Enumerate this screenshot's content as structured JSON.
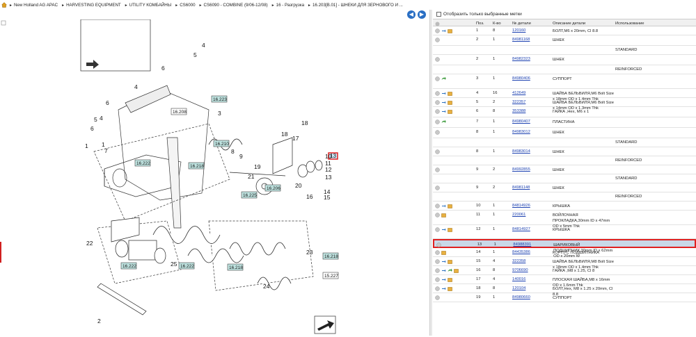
{
  "breadcrumb": [
    "New Holland AG APAC",
    "HARVESTING EQUIPMENT",
    "UTILITY КОМБАЙНЫ",
    "CS6000",
    "CS6090 - COMBINE (9/06-12/08)",
    "16 - Разгрузка",
    "16.203[B.01] - ШНЕКИ ДЛЯ ЗЕРНОВОГО И ..."
  ],
  "filter_label": "Отобразить только выбранные метки",
  "columns": [
    "Поз.",
    "К-во",
    "№ детали",
    "Описание детали",
    "Использование"
  ],
  "rows": [
    {
      "pos": "1",
      "qty": "8",
      "part": "120160",
      "desc": "БОЛТ,M6 x 20mm, Cl 8.8",
      "use": "",
      "icons": [
        "info",
        "swap",
        "box"
      ]
    },
    {
      "pos": "2",
      "qty": "1",
      "part": "84981168",
      "desc": "ШНЕК",
      "use": "",
      "sub": "STANDARD",
      "icons": [
        "info"
      ]
    },
    {
      "pos": "2",
      "qty": "1",
      "part": "84982323",
      "desc": "ШНЕК",
      "use": "",
      "sub": "REINFORCED",
      "icons": [
        "info"
      ]
    },
    {
      "pos": "3",
      "qty": "1",
      "part": "84980406",
      "desc": "СУППОРТ",
      "use": "",
      "icons": [
        "info",
        "arrow"
      ]
    },
    {
      "pos": "4",
      "qty": "16",
      "part": "412649",
      "desc": "ШАЙБА БЕЛЬВИЛЯ,M6 Bolt Size x 18mm OD x 1.4mm Thk",
      "use": "",
      "icons": [
        "info",
        "swap",
        "box"
      ]
    },
    {
      "pos": "5",
      "qty": "2",
      "part": "322357",
      "desc": "ШАЙБА БЕЛЬВИЛЯ,M6 Bolt Size x 14mm OD x 1.3mm Thk",
      "use": "",
      "icons": [
        "info",
        "swap",
        "box"
      ]
    },
    {
      "pos": "6",
      "qty": "8",
      "part": "353388",
      "desc": "ГАЙКА ,Hex, M6 x 1",
      "use": "",
      "icons": [
        "info",
        "swap",
        "box"
      ]
    },
    {
      "pos": "7",
      "qty": "1",
      "part": "84980407",
      "desc": "ПЛАСТИНА",
      "use": "",
      "icons": [
        "info",
        "arrow"
      ]
    },
    {
      "pos": "8",
      "qty": "1",
      "part": "84983012",
      "desc": "ШНЕК",
      "use": "",
      "sub": "STANDARD",
      "icons": [
        "info"
      ]
    },
    {
      "pos": "8",
      "qty": "1",
      "part": "84983014",
      "desc": "ШНЕК",
      "use": "",
      "sub": "REINFORCED",
      "icons": [
        "info"
      ]
    },
    {
      "pos": "9",
      "qty": "2",
      "part": "84992855",
      "desc": "ШНЕК",
      "use": "",
      "sub": "STANDARD",
      "icons": [
        "info"
      ]
    },
    {
      "pos": "9",
      "qty": "2",
      "part": "84981148",
      "desc": "ШНЕК",
      "use": "",
      "sub": "REINFORCED",
      "icons": [
        "info"
      ]
    },
    {
      "pos": "10",
      "qty": "1",
      "part": "84814926",
      "desc": "КРЫШКА",
      "use": "",
      "icons": [
        "info",
        "swap",
        "box"
      ]
    },
    {
      "pos": "11",
      "qty": "1",
      "part": "220061",
      "desc": "ВОЙЛОЧНАЯ ПРОКЛАДКА,30mm ID x 47mm OD x 5mm Thk",
      "use": "",
      "icons": [
        "info",
        "box"
      ]
    },
    {
      "pos": "12",
      "qty": "1",
      "part": "84814927",
      "desc": "КРЫШКА",
      "use": "",
      "icons": [
        "info",
        "swap",
        "box"
      ]
    },
    {
      "pos": "13",
      "qty": "1",
      "part": "84988391",
      "desc": "ШАРИКОВЫЙ ПОДШИПНИК,30mm ID x 62mm OD x 20mm W",
      "use": "",
      "selected": true,
      "icons": [
        "info"
      ]
    },
    {
      "pos": "14",
      "qty": "1",
      "part": "84435386",
      "desc": "КОРПУС ПОДШИПНИКА",
      "use": "",
      "icons": [
        "info",
        "box"
      ]
    },
    {
      "pos": "15",
      "qty": "4",
      "part": "322358",
      "desc": "ШАЙБА БЕЛЬВИЛЯ,M8 Bolt Size x 18mm OD x 1.4mm Thk",
      "use": "",
      "icons": [
        "info",
        "swap",
        "box"
      ]
    },
    {
      "pos": "16",
      "qty": "8",
      "part": "9706690",
      "desc": "ГАЙКА ,M8 x 1.25, Cl 8",
      "use": "",
      "icons": [
        "info",
        "swap",
        "arrow",
        "box"
      ]
    },
    {
      "pos": "17",
      "qty": "4",
      "part": "140016",
      "desc": "ПЛОСКАЯ ШАЙБА,M8 x 16mm OD x 1.6mm Thk",
      "use": "",
      "icons": [
        "info",
        "swap",
        "box"
      ]
    },
    {
      "pos": "18",
      "qty": "8",
      "part": "120104",
      "desc": "БОЛТ,Hex, M8 x 1.25 x 20mm, Cl 8.8",
      "use": "",
      "icons": [
        "info",
        "swap",
        "box"
      ]
    },
    {
      "pos": "19",
      "qty": "1",
      "part": "84980660",
      "desc": "СУППОРТ",
      "use": "",
      "icons": [
        "info"
      ]
    }
  ],
  "callouts": [
    "16.208",
    "16.223",
    "16.210",
    "16.222",
    "16.218",
    "16.206",
    "16.225",
    "16.222",
    "16.222",
    "16.218",
    "16.218",
    "15.227",
    "13"
  ],
  "diagram_numbers": [
    "4",
    "5",
    "6",
    "4",
    "6",
    "5",
    "4",
    "6",
    "1",
    "1",
    "7",
    "3",
    "18",
    "17",
    "18",
    "19",
    "9",
    "8",
    "10",
    "11",
    "12",
    "13",
    "20",
    "21",
    "14",
    "15",
    "16",
    "22",
    "25",
    "23",
    "24",
    "2"
  ]
}
